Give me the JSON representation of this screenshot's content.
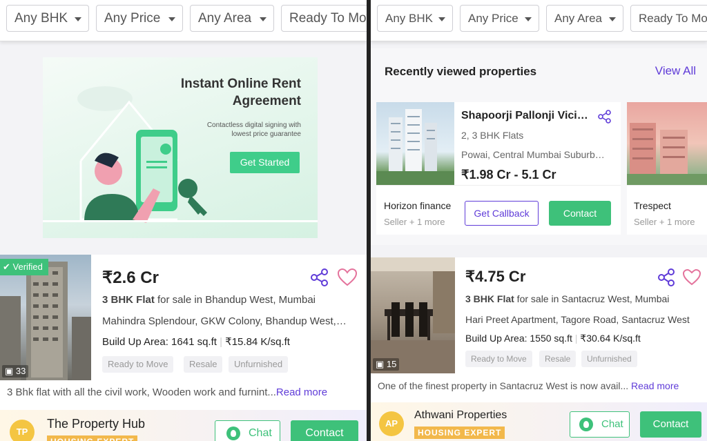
{
  "left": {
    "filters": [
      "Any BHK",
      "Any Price",
      "Any Area",
      "Ready To Move"
    ],
    "banner": {
      "heading_line1": "Instant Online Rent",
      "heading_line2": "Agreement",
      "subtext_line1": "Contactless digital signing with",
      "subtext_line2": "lowest price guarantee",
      "cta": "Get Started"
    },
    "listing": {
      "verified": "Verified",
      "photo_count": "33",
      "price": "₹2.6 Cr",
      "config": "3 BHK Flat",
      "title_rest": " for sale in Bhandup West, Mumbai",
      "address_project": "Mahindra Splendour",
      "address_rest": ", GKW Colony, Bhandup West, Mumbai",
      "area_label": "Build Up Area: 1641 sq.ft",
      "rate": "₹15.84 K/sq.ft",
      "tags": [
        "Ready to Move",
        "Resale",
        "Unfurnished"
      ],
      "description": "3 Bhk flat with all the civil work, Wooden work and furnint...",
      "read_more": "Read more"
    },
    "agent": {
      "initials": "TP",
      "name": "The Property Hub",
      "badge": "HOUSING EXPERT",
      "chat": "Chat",
      "contact": "Contact"
    }
  },
  "right": {
    "filters": [
      "Any BHK",
      "Any Price",
      "Any Area",
      "Ready To Move"
    ],
    "recent": {
      "title": "Recently viewed properties",
      "view_all": "View All",
      "card1": {
        "name": "Shapoorji Pallonji Vicinia",
        "config": "2, 3 BHK Flats",
        "location": "Powai, Central Mumbai Suburbs, Mumbai",
        "price": "₹1.98 Cr - 5.1 Cr",
        "seller": "Horizon finance",
        "seller_sub": "Seller + 1 more",
        "callback": "Get Callback",
        "contact": "Contact"
      },
      "card2": {
        "seller": "Trespect",
        "seller_sub": "Seller + 1 more"
      }
    },
    "listing": {
      "photo_count": "15",
      "price": "₹4.75 Cr",
      "config": "3 BHK Flat",
      "title_rest": " for sale in Santacruz West, Mumbai",
      "address_project": "Hari Preet Apartment",
      "address_rest": ", Tagore Road, Santacruz West",
      "area_label": "Build Up Area: 1550 sq.ft",
      "rate": "₹30.64 K/sq.ft",
      "tags": [
        "Ready to Move",
        "Resale",
        "Unfurnished"
      ],
      "description": "One of the finest property in Santacruz West is now avail...",
      "read_more": "Read more"
    },
    "agent": {
      "initials": "AP",
      "name": "Athwani Properties",
      "badge": "HOUSING EXPERT",
      "chat": "Chat",
      "contact": "Contact"
    }
  },
  "colors": {
    "accent_green": "#3ec17a",
    "accent_purple": "#5f3bd8",
    "heart_pink": "#e4739c",
    "badge_gold": "#f2b84b"
  }
}
